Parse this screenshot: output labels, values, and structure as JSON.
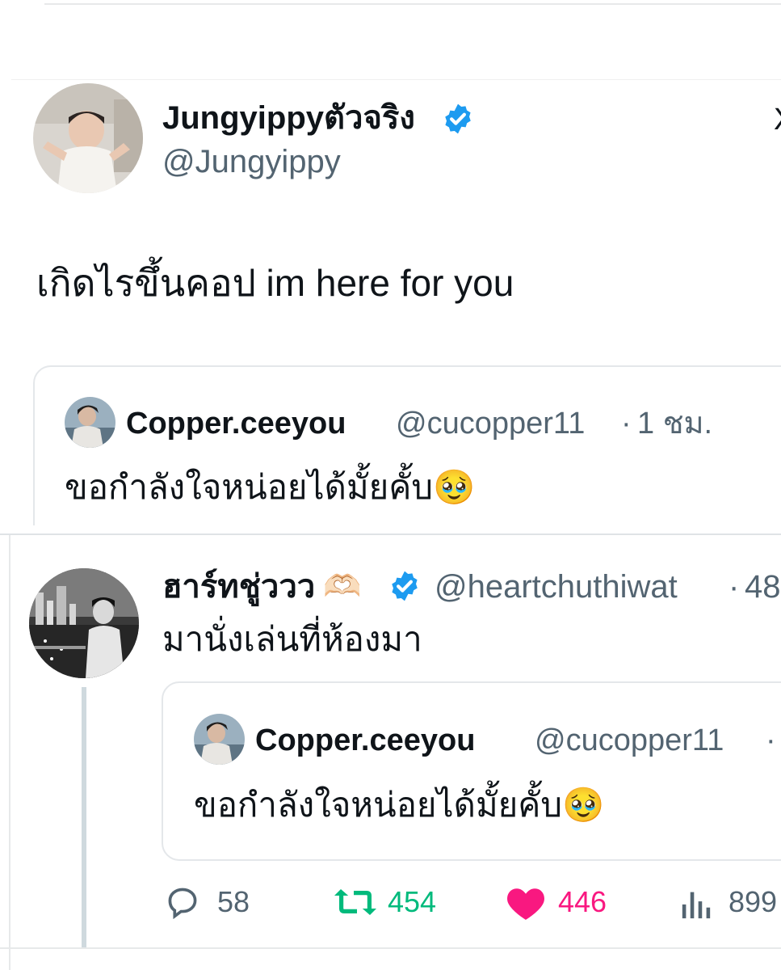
{
  "main_tweet": {
    "author_name": "Jungyippyตัวจริง",
    "handle": "@Jungyippy",
    "text": "เกิดไรขึ้นคอป im here for you",
    "more_glyph": "X"
  },
  "quoted_tweet_1": {
    "author_name": "Copper.ceeyou",
    "handle": "@cucopper11",
    "separator": "·",
    "time": "1 ชม.",
    "text": "ขอกำลังใจหน่อยได้มั้ยคั้บ",
    "emoji": "🥹"
  },
  "reply_tweet": {
    "author_name": "ฮาร์ทชู่ววว",
    "name_emoji": "🫶🏻",
    "handle": "@heartchuthiwat",
    "separator": "·",
    "time": "48",
    "text": "มานั่งเล่นที่ห้องมา"
  },
  "quoted_tweet_2": {
    "author_name": "Copper.ceeyou",
    "handle": "@cucopper11",
    "separator": "·",
    "text": "ขอกำลังใจหน่อยได้มั้ยคั้บ",
    "emoji": "🥹"
  },
  "metrics": {
    "replies": "58",
    "retweets": "454",
    "likes": "446",
    "views": "899"
  },
  "colors": {
    "verified": "#1d9bf0",
    "retweet": "#00ba7c",
    "like": "#f91880",
    "muted": "#536471"
  }
}
